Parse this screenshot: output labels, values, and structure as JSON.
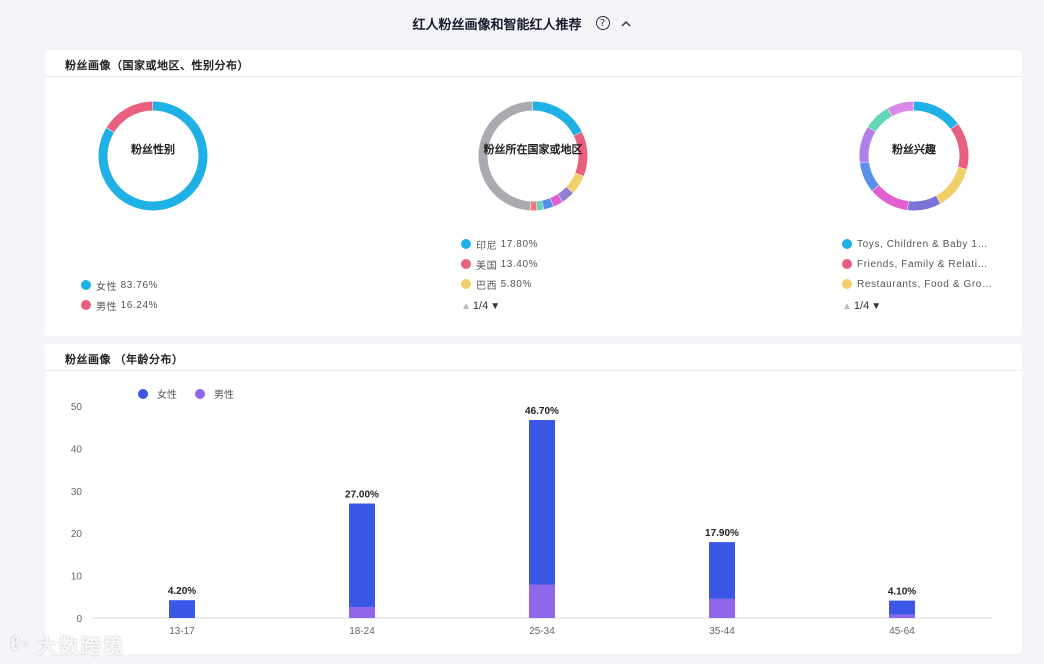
{
  "header": {
    "title": "红人粉丝画像和智能红人推荐",
    "help_icon": "?",
    "collapse_icon": "chevron-up-icon"
  },
  "region_card": {
    "title": "粉丝画像（国家或地区、性别分布）",
    "gender": {
      "center_label": "粉丝性别",
      "slices": [
        {
          "label": "女性",
          "value": 83.76,
          "display": "83.76%",
          "color": "#1fb0e6"
        },
        {
          "label": "男性",
          "value": 16.24,
          "display": "16.24%",
          "color": "#e8607e"
        }
      ]
    },
    "country": {
      "center_label": "粉丝所在国家或地区",
      "legend": [
        {
          "label": "印尼",
          "display": "17.80%",
          "color": "#1fb0e6"
        },
        {
          "label": "美国",
          "display": "13.40%",
          "color": "#e8607e"
        },
        {
          "label": "巴西",
          "display": "5.80%",
          "color": "#f3cf6b"
        }
      ],
      "pager": "1/4"
    },
    "interest": {
      "center_label": "粉丝兴趣",
      "legend": [
        {
          "label": "Toys, Children & Baby 15...",
          "color": "#1fb0e6"
        },
        {
          "label": "Friends, Family & Relatio...",
          "color": "#e8607e"
        },
        {
          "label": "Restaurants, Food & Gro...",
          "color": "#f3cf6b"
        }
      ],
      "pager": "1/4"
    }
  },
  "age_card": {
    "title": "粉丝画像  （年龄分布）",
    "legend": [
      {
        "label": "女性",
        "color": "#3a57e8"
      },
      {
        "label": "男性",
        "color": "#8f67e8"
      }
    ]
  },
  "chart_data": [
    {
      "type": "pie",
      "title": "粉丝性别",
      "categories": [
        "女性",
        "男性"
      ],
      "values": [
        83.76,
        16.24
      ]
    },
    {
      "type": "bar",
      "title": "",
      "categories": [
        "13-17",
        "18-24",
        "25-34",
        "35-44",
        "45-64"
      ],
      "series": [
        {
          "name": "女性",
          "values": [
            4.2,
            24.4,
            38.8,
            13.4,
            3.3
          ],
          "color": "#3a57e8"
        },
        {
          "name": "男性",
          "values": [
            0.0,
            2.6,
            7.9,
            4.5,
            0.8
          ],
          "color": "#8f67e8"
        }
      ],
      "totals": [
        "4.20%",
        "27.00%",
        "46.70%",
        "17.90%",
        "4.10%"
      ],
      "total_values": [
        4.2,
        27.0,
        46.7,
        17.9,
        4.1
      ],
      "yticks": [
        0,
        10,
        20,
        30,
        40,
        50
      ],
      "ylim": [
        0,
        50
      ],
      "legend_position": "top-left",
      "grid": false
    }
  ],
  "watermark": {
    "text": "大数跨境"
  }
}
